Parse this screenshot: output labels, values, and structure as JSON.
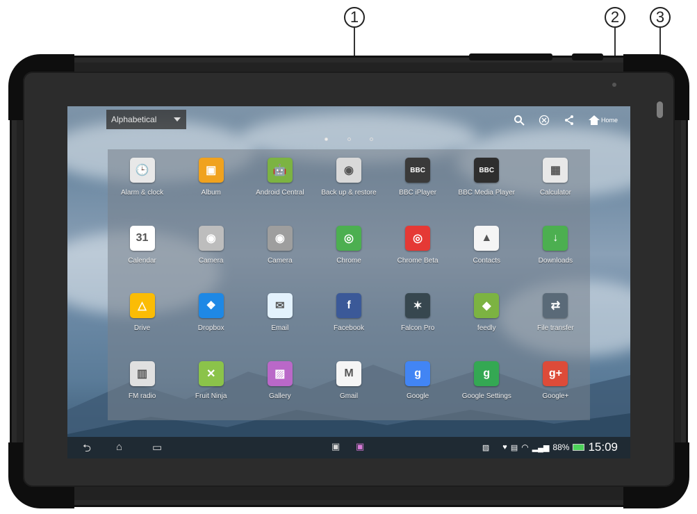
{
  "callouts": [
    "1",
    "2",
    "3"
  ],
  "launcher": {
    "sort_label": "Alphabetical",
    "home_label": "Home",
    "page_count": 3,
    "active_page": 1
  },
  "apps": [
    {
      "label": "Alarm & clock",
      "icon": "clock-icon",
      "bg": "#e8e8e8",
      "glyph": "🕒"
    },
    {
      "label": "Album",
      "icon": "album-icon",
      "bg": "#f0a21e",
      "glyph": "▣"
    },
    {
      "label": "Android Central",
      "icon": "android-central-icon",
      "bg": "#7cb342",
      "glyph": "🤖"
    },
    {
      "label": "Back up & restore",
      "icon": "backup-icon",
      "bg": "#d9d9d9",
      "glyph": "◉"
    },
    {
      "label": "BBC iPlayer",
      "icon": "bbc-iplayer-icon",
      "bg": "#3a3a3a",
      "glyph": "BBC"
    },
    {
      "label": "BBC Media Player",
      "icon": "bbc-media-player-icon",
      "bg": "#2e2e2e",
      "glyph": "BBC"
    },
    {
      "label": "Calculator",
      "icon": "calculator-icon",
      "bg": "#e8e8e8",
      "glyph": "▦"
    },
    {
      "label": "Calendar",
      "icon": "calendar-icon",
      "bg": "#ffffff",
      "glyph": "31"
    },
    {
      "label": "Camera",
      "icon": "camera-icon",
      "bg": "#bdbdbd",
      "glyph": "◉"
    },
    {
      "label": "Camera",
      "icon": "camera-icon",
      "bg": "#9e9e9e",
      "glyph": "◉"
    },
    {
      "label": "Chrome",
      "icon": "chrome-icon",
      "bg": "#4caf50",
      "glyph": "◎"
    },
    {
      "label": "Chrome Beta",
      "icon": "chrome-beta-icon",
      "bg": "#e53935",
      "glyph": "◎"
    },
    {
      "label": "Contacts",
      "icon": "contacts-icon",
      "bg": "#f5f5f5",
      "glyph": "▲"
    },
    {
      "label": "Downloads",
      "icon": "downloads-icon",
      "bg": "#4caf50",
      "glyph": "↓"
    },
    {
      "label": "Drive",
      "icon": "drive-icon",
      "bg": "#fbbc05",
      "glyph": "△"
    },
    {
      "label": "Dropbox",
      "icon": "dropbox-icon",
      "bg": "#1e88e5",
      "glyph": "❖"
    },
    {
      "label": "Email",
      "icon": "email-icon",
      "bg": "#e3f2fd",
      "glyph": "✉"
    },
    {
      "label": "Facebook",
      "icon": "facebook-icon",
      "bg": "#3b5998",
      "glyph": "f"
    },
    {
      "label": "Falcon Pro",
      "icon": "falcon-pro-icon",
      "bg": "#37474f",
      "glyph": "✶"
    },
    {
      "label": "feedly",
      "icon": "feedly-icon",
      "bg": "#7cb342",
      "glyph": "◆"
    },
    {
      "label": "File transfer",
      "icon": "file-transfer-icon",
      "bg": "#5a6a78",
      "glyph": "⇄"
    },
    {
      "label": "FM radio",
      "icon": "fm-radio-icon",
      "bg": "#e0e0e0",
      "glyph": "▥"
    },
    {
      "label": "Fruit Ninja",
      "icon": "fruit-ninja-icon",
      "bg": "#8bc34a",
      "glyph": "✕"
    },
    {
      "label": "Gallery",
      "icon": "gallery-icon",
      "bg": "#ba68c8",
      "glyph": "▨"
    },
    {
      "label": "Gmail",
      "icon": "gmail-icon",
      "bg": "#f5f5f5",
      "glyph": "M"
    },
    {
      "label": "Google",
      "icon": "google-icon",
      "bg": "#4285f4",
      "glyph": "g"
    },
    {
      "label": "Google Settings",
      "icon": "google-settings-icon",
      "bg": "#34a853",
      "glyph": "g"
    },
    {
      "label": "Google+",
      "icon": "google-plus-icon",
      "bg": "#dd4b39",
      "glyph": "g+"
    }
  ],
  "statusbar": {
    "battery": "88%",
    "time": "15:09"
  }
}
